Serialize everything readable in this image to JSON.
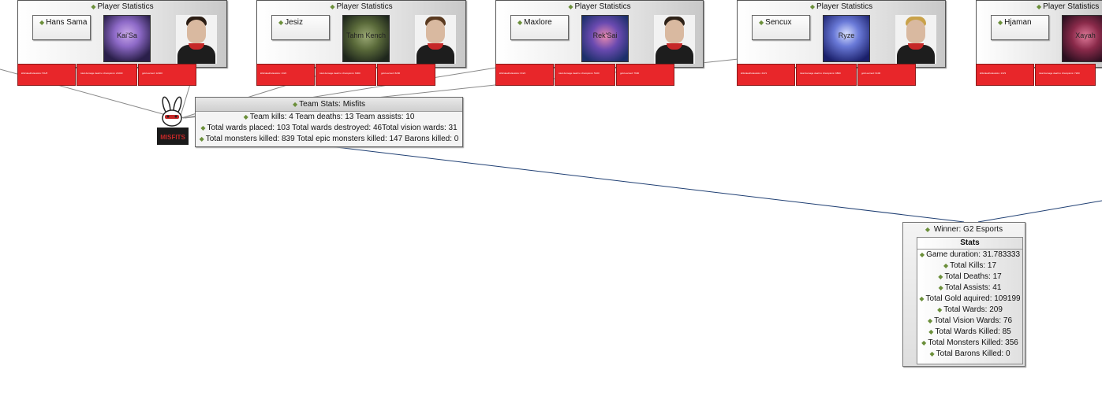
{
  "players": [
    {
      "card_title": "Player Statistics",
      "name": "Hans Sama",
      "champion": "Kai'Sa",
      "champ_colors": [
        "#2a1f4a",
        "#8e6ac8"
      ],
      "hair": "#2b1d14",
      "stats": [
        "kills/deaths/assists: 5/1/8",
        "total damage dealt to champions: 21000",
        "gold earned: 12400"
      ]
    },
    {
      "card_title": "Player Statistics",
      "name": "Jesiz",
      "champion": "Tahm Kench",
      "champ_colors": [
        "#2e3a2c",
        "#7a8a5a"
      ],
      "hair": "#5a3a20",
      "stats": [
        "kills/deaths/assists: 1/3/2",
        "total damage dealt to champions: 6300",
        "gold earned: 8200"
      ]
    },
    {
      "card_title": "Player Statistics",
      "name": "Maxlore",
      "champion": "Rek'Sai",
      "champ_colors": [
        "#1c2f6a",
        "#e04a8a"
      ],
      "hair": "#2e2218",
      "stats": [
        "kills/deaths/assists: 0/4/4",
        "total damage dealt to champions: 5100",
        "gold earned: 7600"
      ]
    },
    {
      "card_title": "Player Statistics",
      "name": "Sencux",
      "champion": "Ryze",
      "champ_colors": [
        "#1a1f6a",
        "#8a9ae8"
      ],
      "hair": "#c9a24a",
      "stats": [
        "kills/deaths/assists: 2/2/1",
        "total damage dealt to champions: 9800",
        "gold earned: 9100"
      ]
    },
    {
      "card_title": "Player Statistics",
      "name": "Hjaman",
      "champion": "Xayah",
      "champ_colors": [
        "#4a1f3a",
        "#c04a6a"
      ],
      "hair": "#2a1a12",
      "stats": [
        "kills/deaths/assists: 1/3/3",
        "total damage dealt to champions: 7200",
        "gold earned: 8300"
      ]
    }
  ],
  "team_stats": {
    "header": "Team Stats:  Misfits",
    "line1": "Team kills:  4  Team deaths:  13  Team assists:  10",
    "line2": "Total wards placed:  103  Total wards destroyed:  46Total vision wards:  31",
    "line3": "Total monsters killed:  839  Total epic monsters killed:  147  Barons killed:  0",
    "logo_text": "MISFITS",
    "accent": "#c62828"
  },
  "winner": {
    "header": "Winner:  G2 Esports",
    "stats_title": "Stats",
    "items": [
      "Game duration: 31.783333",
      "Total Kills: 17",
      "Total Deaths: 17",
      "Total Assists: 41",
      "Total Gold aquired: 109199",
      "Total Wards: 209",
      "Total Vision Wards: 76",
      "Total Wards Killed: 85",
      "Total Monsters Killed: 356",
      "Total Barons Killed: 0"
    ]
  },
  "colors": {
    "stat_red": "#e8262a",
    "diamond": "#6b8f3a",
    "connector": "#1f3f73",
    "line_gray": "#888888"
  }
}
